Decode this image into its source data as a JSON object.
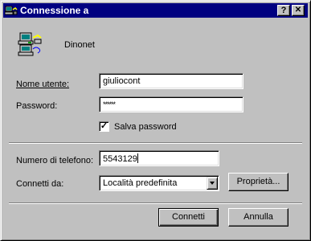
{
  "window": {
    "title": "Connessione a",
    "help_label": "?",
    "close_label": "✕"
  },
  "connection": {
    "name": "Dinonet",
    "icon": "dialup-connection-icon"
  },
  "form": {
    "username_label": "Nome utente:",
    "username_value": "giuliocont",
    "password_label": "Password:",
    "password_value": "******",
    "save_password_label": "Salva password",
    "save_password_checked": true,
    "phone_label": "Numero di telefono:",
    "phone_value": "5543129",
    "dial_from_label": "Connetti da:",
    "dial_from_value": "Località predefinita",
    "properties_label": "Proprietà..."
  },
  "buttons": {
    "connect_label": "Connetti",
    "cancel_label": "Annulla"
  }
}
